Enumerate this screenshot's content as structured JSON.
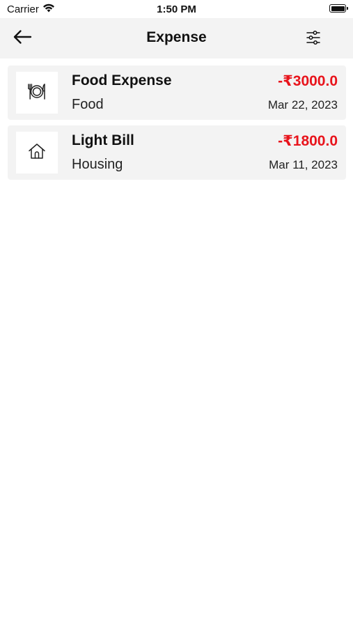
{
  "status_bar": {
    "carrier": "Carrier",
    "time": "1:50 PM"
  },
  "nav": {
    "title": "Expense",
    "back_icon": "arrow-left-icon",
    "filter_icon": "sliders-icon"
  },
  "expenses": [
    {
      "title": "Food Expense",
      "category": "Food",
      "amount": "-₹3000.0",
      "date": "Mar 22, 2023",
      "icon": "plate-cutlery-icon"
    },
    {
      "title": "Light Bill",
      "category": "Housing",
      "amount": "-₹1800.0",
      "date": "Mar 11, 2023",
      "icon": "house-icon"
    }
  ],
  "colors": {
    "amount_negative": "#e8141c",
    "nav_background": "#f3f3f3",
    "card_background": "#f3f3f3"
  }
}
